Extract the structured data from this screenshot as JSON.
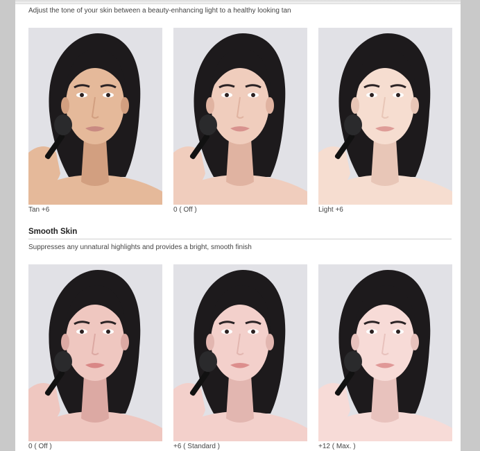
{
  "tone": {
    "description": "Adjust the tone of your skin between a beauty-enhancing light to a healthy looking tan",
    "photos": [
      {
        "caption": "Tan +6",
        "skin": "#e5b99a",
        "shade": "#d29f80",
        "lip": "#c98a82"
      },
      {
        "caption": "0 ( Off )",
        "skin": "#f0cdbd",
        "shade": "#e0b3a1",
        "lip": "#d8928e"
      },
      {
        "caption": "Light +6",
        "skin": "#f6ddd0",
        "shade": "#e8c6b7",
        "lip": "#de9c97"
      }
    ]
  },
  "smooth": {
    "heading": "Smooth Skin",
    "description": "Suppresses any unnatural highlights and provides a bright, smooth finish",
    "photos": [
      {
        "caption": "0 ( Off )",
        "skin": "#efc7c0",
        "shade": "#dca9a3",
        "lip": "#d98786"
      },
      {
        "caption": "+6 ( Standard )",
        "skin": "#f3d0cb",
        "shade": "#e2b6b0",
        "lip": "#dc8e8d"
      },
      {
        "caption": "+12 ( Max. )",
        "skin": "#f7dbd7",
        "shade": "#e8c2bd",
        "lip": "#e09897"
      }
    ]
  }
}
